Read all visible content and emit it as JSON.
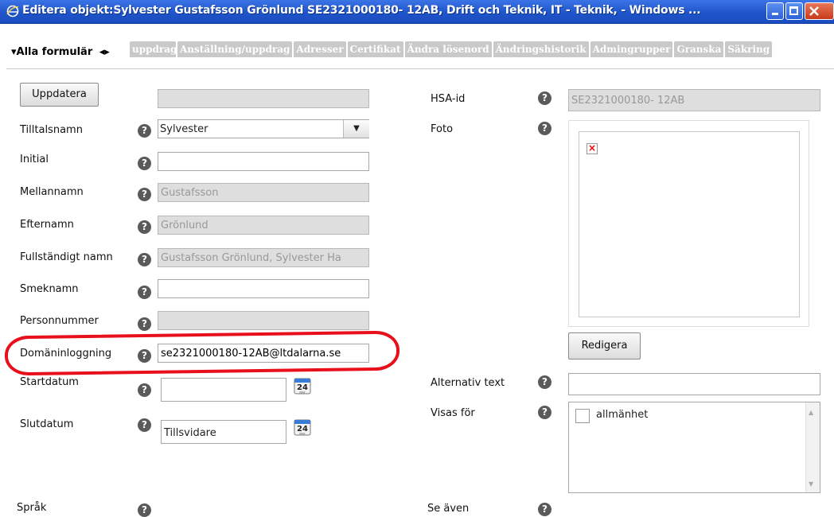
{
  "window": {
    "title": "Editera objekt:Sylvester Gustafsson Grönlund SE2321000180- 12AB, Drift och Teknik, IT - Teknik,  - Windows ...",
    "icon": "ie-icon",
    "controls": [
      "minimize-icon",
      "maximize-icon",
      "close-icon"
    ]
  },
  "tabs": {
    "all_label": "▾Alla formulär",
    "nav_arrows": "◂▸",
    "items": [
      "uppdrag",
      "Anställning/uppdrag",
      "Adresser",
      "Certifikat",
      "Ändra lösenord",
      "Ändringshistorik",
      "Admingrupper",
      "Granska",
      "Säkring"
    ]
  },
  "form": {
    "update_button": "Uppdatera",
    "help_glyph": "?",
    "fields": {
      "tilltalsnamn": {
        "label": "Tilltalsnamn",
        "value": "Sylvester",
        "select_arrow": "▼"
      },
      "initial": {
        "label": "Initial",
        "value": ""
      },
      "mellannamn": {
        "label": "Mellannamn",
        "value": "Gustafsson"
      },
      "efternamn": {
        "label": "Efternamn",
        "value": "Grönlund"
      },
      "fullstandigt_namn": {
        "label": "Fullständigt namn",
        "value": "Gustafsson Grönlund, Sylvester Ha"
      },
      "smeknamn": {
        "label": "Smeknamn",
        "value": ""
      },
      "personnummer": {
        "label": "Personnummer",
        "value": ""
      },
      "domaninloggning": {
        "label": "Domäninloggning",
        "value": "se2321000180-12AB@ltdalarna.se"
      },
      "startdatum": {
        "label": "Startdatum",
        "value": ""
      },
      "slutdatum": {
        "label": "Slutdatum",
        "value": "Tillsvidare"
      },
      "sprak": {
        "label": "Språk"
      }
    },
    "calendar": {
      "day": "24",
      "month": "MAY"
    },
    "right": {
      "hsa_id": {
        "label": "HSA-id",
        "value": "SE2321000180- 12AB"
      },
      "foto": {
        "label": "Foto",
        "broken_image": "×"
      },
      "edit_button": "Redigera",
      "alternativ_text": {
        "label": "Alternativ text",
        "value": ""
      },
      "visas_for": {
        "label": "Visas för",
        "option": "allmänhet"
      },
      "se_aven": {
        "label": "Se även"
      }
    }
  },
  "colors": {
    "annotation": "#e8101a",
    "tab_bg": "#c9c9c9",
    "titlebar": "#2459d3"
  }
}
